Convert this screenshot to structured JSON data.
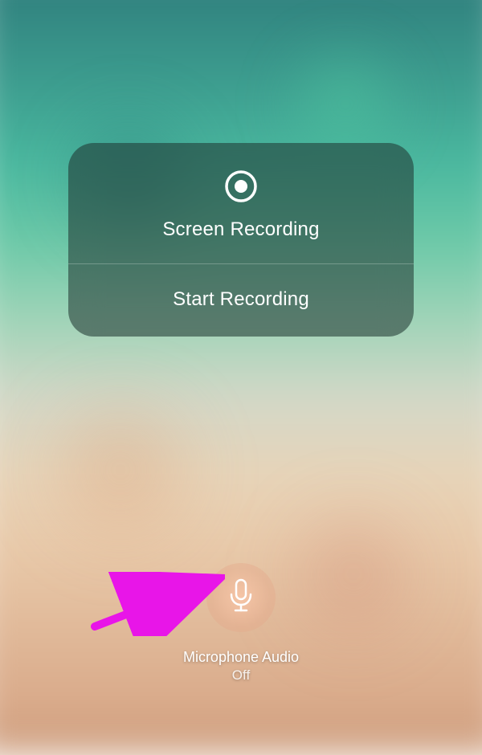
{
  "card": {
    "title": "Screen Recording",
    "action_label": "Start Recording"
  },
  "mic": {
    "label": "Microphone Audio",
    "status": "Off"
  }
}
